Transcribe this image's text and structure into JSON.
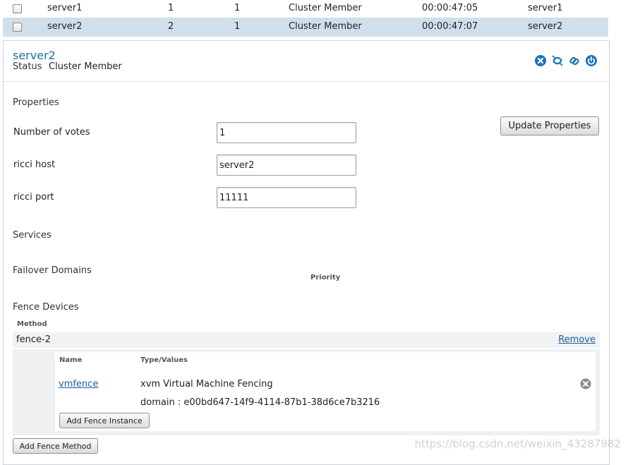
{
  "nodes": [
    {
      "name": "server1",
      "node_id": "1",
      "votes": "1",
      "status": "Cluster Member",
      "uptime": "00:00:47:05",
      "ricci_host": "server1",
      "selected": false
    },
    {
      "name": "server2",
      "node_id": "2",
      "votes": "1",
      "status": "Cluster Member",
      "uptime": "00:00:47:07",
      "ricci_host": "server2",
      "selected": true
    }
  ],
  "detail": {
    "title": "server2",
    "status_label": "Status",
    "status_value": "Cluster Member",
    "icons": [
      "leave-cluster-icon",
      "reboot-icon",
      "join-cluster-icon",
      "power-icon"
    ]
  },
  "properties": {
    "heading": "Properties",
    "update_button": "Update Properties",
    "fields": [
      {
        "label": "Number of votes",
        "value": "1"
      },
      {
        "label": "ricci host",
        "value": "server2"
      },
      {
        "label": "ricci port",
        "value": "11111"
      }
    ]
  },
  "services": {
    "heading": "Services"
  },
  "failover": {
    "heading": "Failover Domains",
    "priority_header": "Priority"
  },
  "fence": {
    "heading": "Fence Devices",
    "method_header": "Method",
    "method_name": "fence-2",
    "remove_label": "Remove",
    "name_header": "Name",
    "type_header": "Type/Values",
    "instance_name": "vmfence",
    "instance_type": "xvm Virtual Machine Fencing",
    "instance_domain": "domain : e00bd647-14f9-4114-87b1-38d6ce7b3216",
    "add_instance_button": "Add Fence Instance",
    "add_method_button": "Add Fence Method"
  },
  "watermark": "https://blog.csdn.net/weixin_43287982",
  "colors": {
    "accent": "#1d6fa3",
    "selected_row": "#cfe0ec",
    "icon_blue": "#1a73b8"
  }
}
